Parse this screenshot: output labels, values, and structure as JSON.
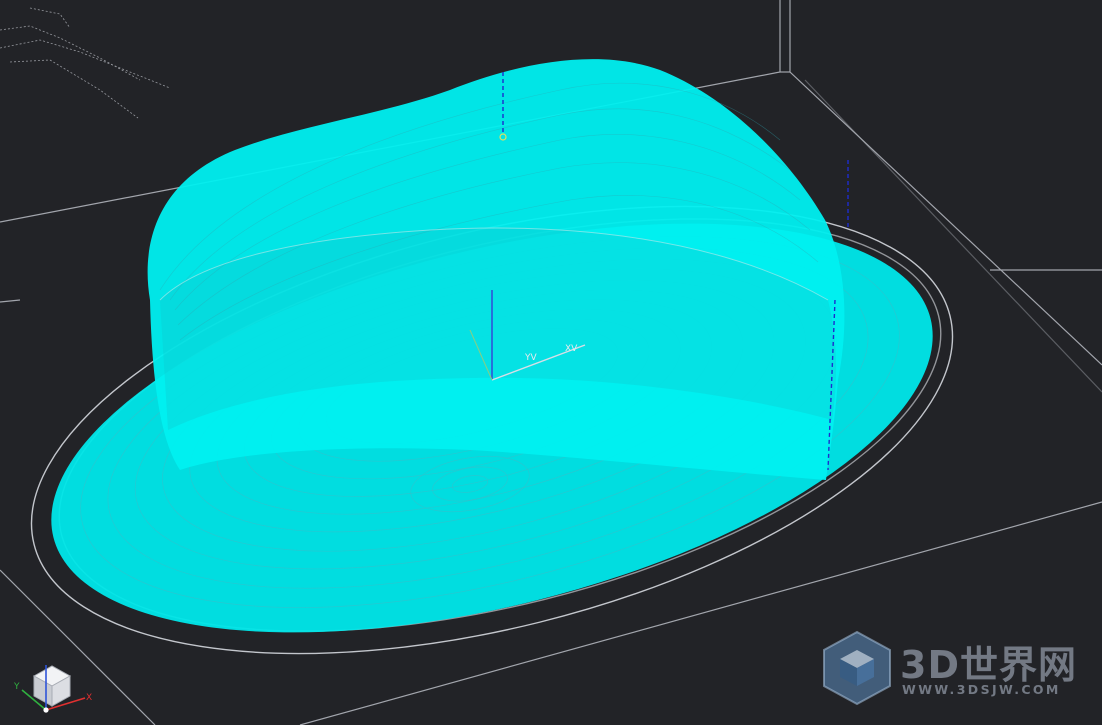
{
  "viewport": {
    "background": "#222327",
    "toolpath_color": "#00f4f4",
    "wireframe_color": "#b9bcc4"
  },
  "origin_triad": {
    "x_label": "XV",
    "y_label": "YV"
  },
  "view_cube": {
    "x_label": "X",
    "y_label": "Y"
  },
  "watermark": {
    "brand": "3D世界网",
    "url": "WWW.3DSJW.COM"
  }
}
